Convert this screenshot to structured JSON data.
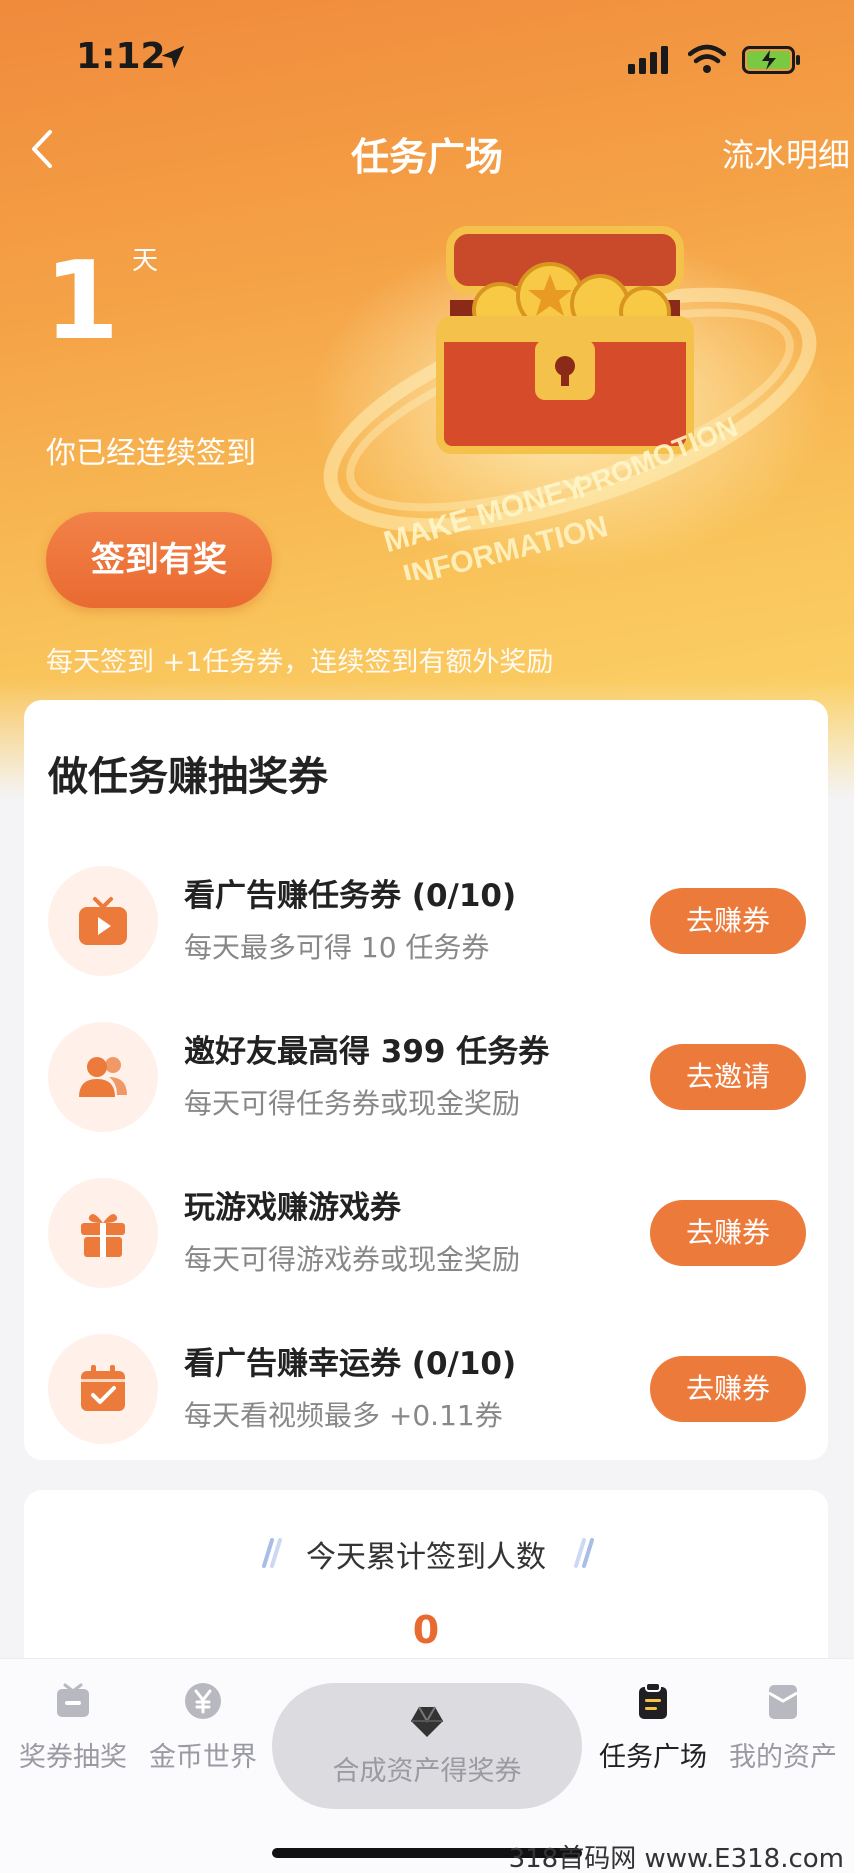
{
  "status_bar": {
    "time": "1:12"
  },
  "nav": {
    "title": "任务广场",
    "right_link": "流水明细"
  },
  "checkin": {
    "days": "1",
    "unit": "天",
    "desc": "你已经连续签到",
    "button": "签到有奖",
    "tip": "每天签到 +1任务券，连续签到有额外奖励"
  },
  "tasks": {
    "title": "做任务赚抽奖券",
    "items": [
      {
        "title": "看广告赚任务券 (0/10)",
        "desc": "每天最多可得 10 任务券",
        "button": "去赚券",
        "icon": "tv-play-icon"
      },
      {
        "title": "邀好友最高得 399 任务券",
        "desc": "每天可得任务券或现金奖励",
        "button": "去邀请",
        "icon": "friends-icon"
      },
      {
        "title": "玩游戏赚游戏券",
        "desc": "每天可得游戏券或现金奖励",
        "button": "去赚券",
        "icon": "gift-icon"
      },
      {
        "title": "看广告赚幸运券 (0/10)",
        "desc": "每天看视频最多 +0.11券",
        "button": "去赚券",
        "icon": "calendar-check-icon"
      }
    ]
  },
  "signin_count": {
    "title": "今天累计签到人数",
    "value": "0"
  },
  "tabbar": {
    "items": [
      {
        "label": "奖券抽奖",
        "icon": "ticket-icon"
      },
      {
        "label": "金币世界",
        "icon": "yen-coin-icon"
      },
      {
        "label": "合成资产得奖券",
        "icon": "gem-icon"
      },
      {
        "label": "任务广场",
        "icon": "clipboard-icon",
        "active": true
      },
      {
        "label": "我的资产",
        "icon": "wallet-icon"
      }
    ]
  },
  "watermark": "318首码网 www.E318.com",
  "colors": {
    "accent": "#ec7a3b",
    "hero_top": "#f08a3c",
    "hero_bottom": "#fbd76c"
  }
}
